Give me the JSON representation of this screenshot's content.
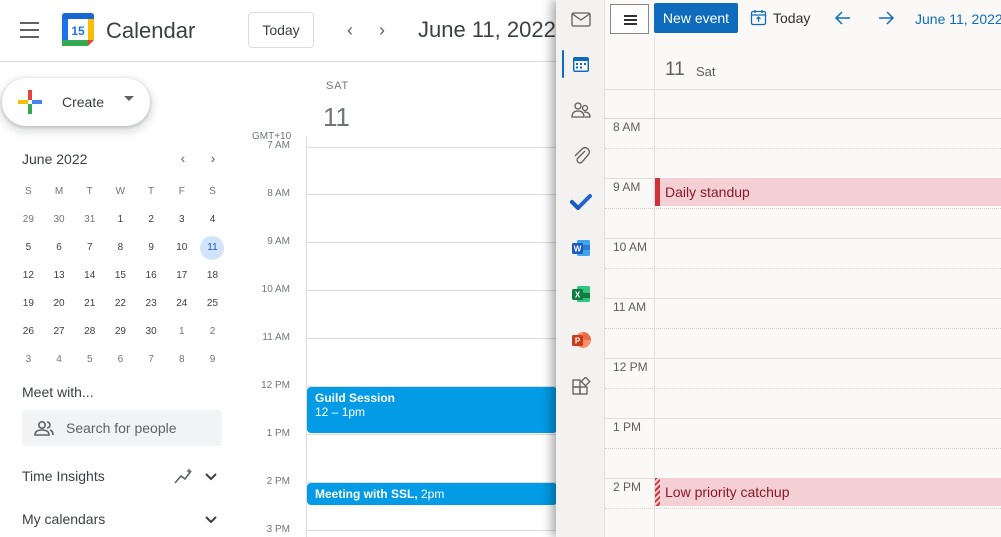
{
  "gcal": {
    "app_title": "Calendar",
    "logo_day": "15",
    "today_button": "Today",
    "prev_icon": "chevron-left-icon",
    "next_icon": "chevron-right-icon",
    "date_title": "June 11, 2022",
    "create_label": "Create",
    "mini": {
      "title": "June 2022",
      "dow": [
        "S",
        "M",
        "T",
        "W",
        "T",
        "F",
        "S"
      ],
      "weeks": [
        [
          "29",
          "30",
          "31",
          "1",
          "2",
          "3",
          "4"
        ],
        [
          "5",
          "6",
          "7",
          "8",
          "9",
          "10",
          "11"
        ],
        [
          "12",
          "13",
          "14",
          "15",
          "16",
          "17",
          "18"
        ],
        [
          "19",
          "20",
          "21",
          "22",
          "23",
          "24",
          "25"
        ],
        [
          "26",
          "27",
          "28",
          "29",
          "30",
          "1",
          "2"
        ],
        [
          "3",
          "4",
          "5",
          "6",
          "7",
          "8",
          "9"
        ]
      ],
      "today": "11"
    },
    "meet_with": "Meet with...",
    "search_people_placeholder": "Search for people",
    "time_insights": "Time Insights",
    "my_calendars": "My calendars",
    "day": {
      "dow": "SAT",
      "num": "11"
    },
    "tz": "GMT+10",
    "times": [
      "7 AM",
      "8 AM",
      "9 AM",
      "10 AM",
      "11 AM",
      "12 PM",
      "1 PM",
      "2 PM",
      "3 PM"
    ],
    "events": [
      {
        "title": "Guild Session",
        "time": "12 – 1pm"
      },
      {
        "title": "Meeting with SSL,",
        "time": " 2pm"
      }
    ],
    "accent": "#039be5"
  },
  "outlook": {
    "new_event": "New event",
    "today": "Today",
    "date_title": "June 11, 2022",
    "day_num": "11",
    "day_dow": "Sat",
    "times": [
      "8 AM",
      "9 AM",
      "10 AM",
      "11 AM",
      "12 PM",
      "1 PM",
      "2 PM"
    ],
    "events": [
      {
        "title": "Daily standup"
      },
      {
        "title": "Low priority catchup"
      }
    ],
    "rail_icons": [
      "mail-icon",
      "calendar-icon",
      "people-icon",
      "paperclip-icon",
      "todo-icon",
      "word-icon",
      "excel-icon",
      "powerpoint-icon",
      "apps-icon"
    ],
    "accent": "#0f6cbd"
  }
}
